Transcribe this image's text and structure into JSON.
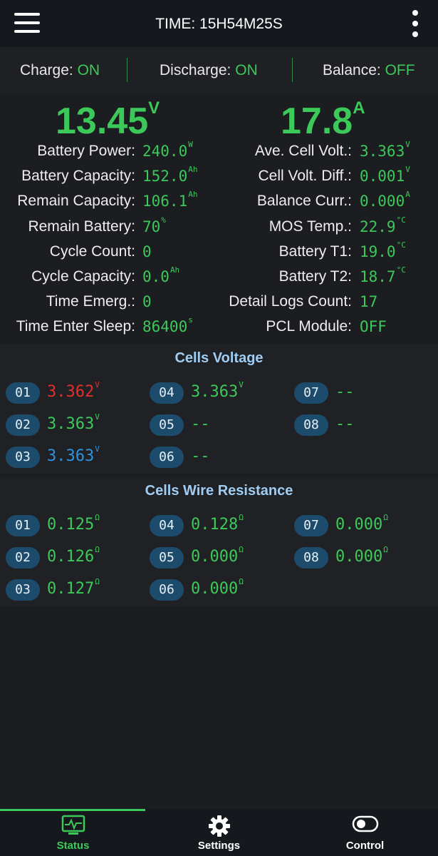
{
  "header": {
    "time": "TIME: 15H54M25S",
    "menu_icon": "hamburger-menu-icon",
    "more_icon": "more-vertical-icon"
  },
  "status": {
    "charge_label": "Charge:",
    "charge_value": "ON",
    "discharge_label": "Discharge:",
    "discharge_value": "ON",
    "balance_label": "Balance:",
    "balance_value": "OFF"
  },
  "summary": {
    "voltage": "13.45",
    "voltage_unit": "V",
    "current": "17.8",
    "current_unit": "A"
  },
  "left_info": [
    {
      "label": "Battery Power:",
      "value": "240.0",
      "unit": "W"
    },
    {
      "label": "Battery Capacity:",
      "value": "152.0",
      "unit": "Ah"
    },
    {
      "label": "Remain Capacity:",
      "value": "106.1",
      "unit": "Ah"
    },
    {
      "label": "Remain Battery:",
      "value": "70",
      "unit": "%"
    },
    {
      "label": "Cycle Count:",
      "value": "0",
      "unit": ""
    },
    {
      "label": "Cycle Capacity:",
      "value": "0.0",
      "unit": "Ah"
    },
    {
      "label": "Time Emerg.:",
      "value": "0",
      "unit": ""
    },
    {
      "label": "Time Enter Sleep:",
      "value": "86400",
      "unit": "s"
    }
  ],
  "right_info": [
    {
      "label": "Ave. Cell Volt.:",
      "value": "3.363",
      "unit": "V"
    },
    {
      "label": "Cell Volt. Diff.:",
      "value": "0.001",
      "unit": "V"
    },
    {
      "label": "Balance Curr.:",
      "value": "0.000",
      "unit": "A"
    },
    {
      "label": "MOS Temp.:",
      "value": "22.9",
      "unit": "°C"
    },
    {
      "label": "Battery T1:",
      "value": "19.0",
      "unit": "°C"
    },
    {
      "label": "Battery T2:",
      "value": "18.7",
      "unit": "°C"
    },
    {
      "label": "Detail Logs Count:",
      "value": "17",
      "unit": ""
    },
    {
      "label": "PCL Module:",
      "value": "OFF",
      "unit": ""
    }
  ],
  "cells_voltage": {
    "title": "Cells Voltage",
    "cells": [
      {
        "id": "01",
        "value": "3.362",
        "unit": "V",
        "color": "#e0302b"
      },
      {
        "id": "02",
        "value": "3.363",
        "unit": "V",
        "color": "#3cc95a"
      },
      {
        "id": "03",
        "value": "3.363",
        "unit": "V",
        "color": "#2d93dd"
      },
      {
        "id": "04",
        "value": "3.363",
        "unit": "V",
        "color": "#3cc95a"
      },
      {
        "id": "05",
        "value": "--",
        "unit": "",
        "color": "#3cc95a"
      },
      {
        "id": "06",
        "value": "--",
        "unit": "",
        "color": "#3cc95a"
      },
      {
        "id": "07",
        "value": "--",
        "unit": "",
        "color": "#3cc95a"
      },
      {
        "id": "08",
        "value": "--",
        "unit": "",
        "color": "#3cc95a"
      }
    ]
  },
  "cells_resistance": {
    "title": "Cells Wire Resistance",
    "cells": [
      {
        "id": "01",
        "value": "0.125",
        "unit": "Ω"
      },
      {
        "id": "02",
        "value": "0.126",
        "unit": "Ω"
      },
      {
        "id": "03",
        "value": "0.127",
        "unit": "Ω"
      },
      {
        "id": "04",
        "value": "0.128",
        "unit": "Ω"
      },
      {
        "id": "05",
        "value": "0.000",
        "unit": "Ω"
      },
      {
        "id": "06",
        "value": "0.000",
        "unit": "Ω"
      },
      {
        "id": "07",
        "value": "0.000",
        "unit": "Ω"
      },
      {
        "id": "08",
        "value": "0.000",
        "unit": "Ω"
      }
    ]
  },
  "nav": {
    "status_label": "Status",
    "settings_label": "Settings",
    "control_label": "Control",
    "active": "Status",
    "accent": "#3cc95a"
  }
}
